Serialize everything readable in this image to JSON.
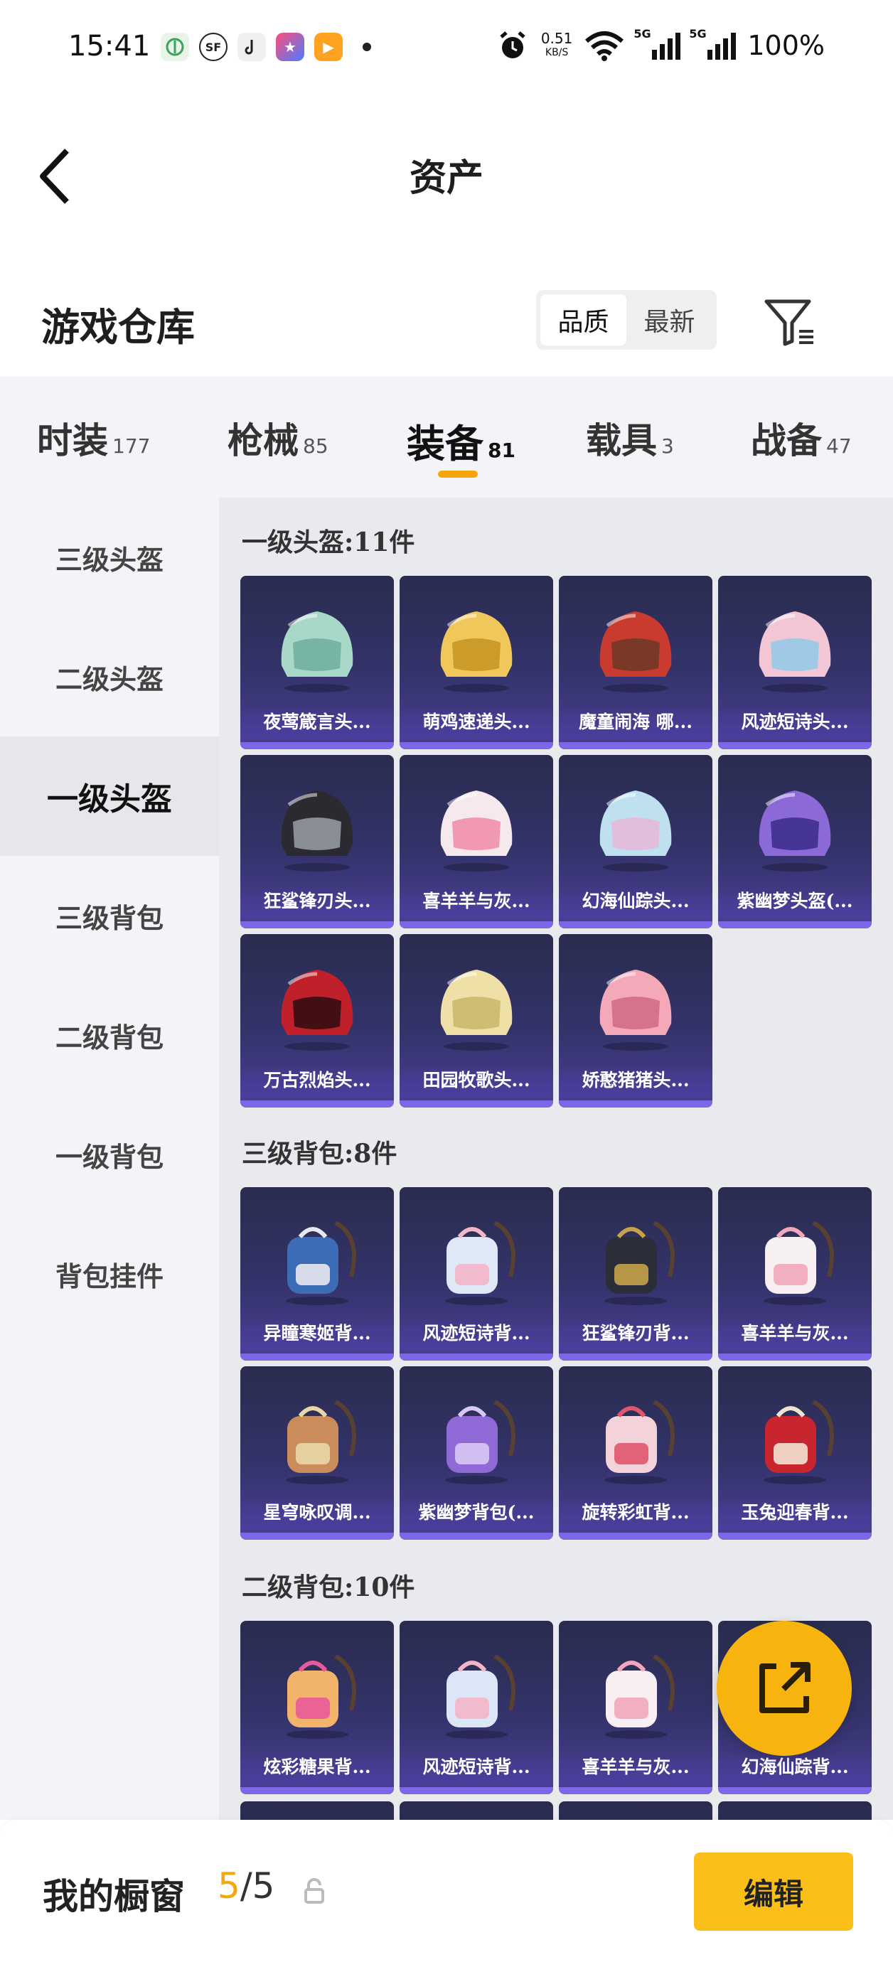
{
  "status_bar": {
    "time": "15:41",
    "net_speed_value": "0.51",
    "net_speed_unit": "KB/S",
    "signal_label_1": "5G",
    "signal_label_2": "5G",
    "battery": "100%",
    "notification_icons": [
      "leaf-app-icon",
      "sf-express-icon",
      "tiktok-icon",
      "star-app-icon",
      "video-app-icon"
    ]
  },
  "header": {
    "title": "资产"
  },
  "warehouse": {
    "title": "游戏仓库",
    "sort_options": [
      "品质",
      "最新"
    ],
    "active_sort": "品质"
  },
  "category_tabs": [
    {
      "label": "时装",
      "count": "177"
    },
    {
      "label": "枪械",
      "count": "85"
    },
    {
      "label": "装备",
      "count": "81",
      "active": true
    },
    {
      "label": "载具",
      "count": "3"
    },
    {
      "label": "战备",
      "count": "47"
    }
  ],
  "sub_nav": [
    "三级头盔",
    "二级头盔",
    "一级头盔",
    "三级背包",
    "二级背包",
    "一级背包",
    "背包挂件"
  ],
  "sub_nav_active": "一级头盔",
  "sections": [
    {
      "title": "一级头盔:11件",
      "items": [
        {
          "name": "夜莺箴言头...",
          "icon": "helmet-icon",
          "color": "#a8d8c8",
          "accent": "#6fae9e"
        },
        {
          "name": "萌鸡速递头...",
          "icon": "helmet-icon",
          "color": "#f0c75a",
          "accent": "#c49422"
        },
        {
          "name": "魔童闹海 哪...",
          "icon": "helmet-icon",
          "color": "#c93a2f",
          "accent": "#6b3a24"
        },
        {
          "name": "风迹短诗头...",
          "icon": "helmet-icon",
          "color": "#f3c6d6",
          "accent": "#8fc9e6"
        },
        {
          "name": "狂鲨锋刃头...",
          "icon": "helmet-icon",
          "color": "#2a2a30",
          "accent": "#9aa0a8"
        },
        {
          "name": "喜羊羊与灰...",
          "icon": "helmet-icon",
          "color": "#f6e9ee",
          "accent": "#f08aa8"
        },
        {
          "name": "幻海仙踪头...",
          "icon": "helmet-icon",
          "color": "#bfe0ef",
          "accent": "#e6b7d8"
        },
        {
          "name": "紫幽梦头盔(...",
          "icon": "helmet-icon",
          "color": "#8b6ad8",
          "accent": "#3a2b8a"
        },
        {
          "name": "万古烈焰头...",
          "icon": "helmet-icon",
          "color": "#c0202a",
          "accent": "#2a0d10"
        },
        {
          "name": "田园牧歌头...",
          "icon": "helmet-icon",
          "color": "#efe0a8",
          "accent": "#c8b76a"
        },
        {
          "name": "娇憨猪猪头...",
          "icon": "helmet-icon",
          "color": "#f4a8b8",
          "accent": "#d06a84"
        }
      ]
    },
    {
      "title": "三级背包:8件",
      "items": [
        {
          "name": "异瞳寒姬背...",
          "icon": "backpack-icon",
          "color": "#3d6bb5",
          "accent": "#e8e8f0"
        },
        {
          "name": "风迹短诗背...",
          "icon": "backpack-icon",
          "color": "#dfe8f6",
          "accent": "#f3b6c9"
        },
        {
          "name": "狂鲨锋刃背...",
          "icon": "backpack-icon",
          "color": "#2b2d38",
          "accent": "#c8a24a"
        },
        {
          "name": "喜羊羊与灰...",
          "icon": "backpack-icon",
          "color": "#f7f0f2",
          "accent": "#f2a7bd"
        },
        {
          "name": "星穹咏叹调...",
          "icon": "backpack-icon",
          "color": "#c98c5a",
          "accent": "#e9d6a8"
        },
        {
          "name": "紫幽梦背包(...",
          "icon": "backpack-icon",
          "color": "#8f6ad6",
          "accent": "#d9c8f5"
        },
        {
          "name": "旋转彩虹背...",
          "icon": "backpack-icon",
          "color": "#f3d2d9",
          "accent": "#e0566c"
        },
        {
          "name": "玉兔迎春背...",
          "icon": "backpack-icon",
          "color": "#c9252e",
          "accent": "#f1e3d2"
        }
      ]
    },
    {
      "title": "二级背包:10件",
      "items": [
        {
          "name": "炫彩糖果背...",
          "icon": "backpack-icon",
          "color": "#f2b46a",
          "accent": "#e85a9a"
        },
        {
          "name": "风迹短诗背...",
          "icon": "backpack-icon",
          "color": "#dbe7f6",
          "accent": "#f3b6c9"
        },
        {
          "name": "喜羊羊与灰...",
          "icon": "backpack-icon",
          "color": "#f7eff2",
          "accent": "#f2a7bd"
        },
        {
          "name": "幻海仙踪背...",
          "icon": "backpack-icon",
          "color": "#bfe0ef",
          "accent": "#e6b7d8"
        }
      ]
    }
  ],
  "showcase": {
    "label": "我的橱窗",
    "current": "5",
    "separator": "/",
    "total": "5"
  },
  "edit_button": "编辑"
}
